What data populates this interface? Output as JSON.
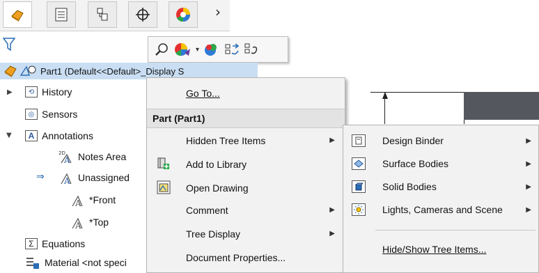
{
  "tabs": {
    "icons": [
      "featuremanager-icon",
      "propertymanager-icon",
      "configurationmanager-icon",
      "dimxpert-icon",
      "display-manager-icon"
    ],
    "overflow": "›"
  },
  "tree": {
    "part_label": "Part1  (Default<<Default>_Display S",
    "items": [
      {
        "label": "History"
      },
      {
        "label": "Sensors"
      },
      {
        "label": "Annotations"
      },
      {
        "label": "Notes Area"
      },
      {
        "label": "Unassigned"
      },
      {
        "label": "*Front"
      },
      {
        "label": "*Top"
      },
      {
        "label": "Equations"
      },
      {
        "label": "Material <not speci"
      }
    ]
  },
  "context_menu": {
    "go_to": "Go To...",
    "header": "Part (Part1)",
    "items": [
      {
        "label": "Hidden Tree Items",
        "has_submenu": true
      },
      {
        "label": "Add to Library",
        "has_submenu": false
      },
      {
        "label": "Open Drawing",
        "has_submenu": false
      },
      {
        "label": "Comment",
        "has_submenu": true
      },
      {
        "label": "Tree Display",
        "has_submenu": true
      },
      {
        "label": "Document Properties...",
        "has_submenu": false
      }
    ]
  },
  "submenu": {
    "items": [
      {
        "label": "Design Binder",
        "has_submenu": true
      },
      {
        "label": "Surface Bodies",
        "has_submenu": true
      },
      {
        "label": "Solid Bodies",
        "has_submenu": true
      },
      {
        "label": "Lights, Cameras and Scene",
        "has_submenu": true
      }
    ],
    "hide_show": "Hide/Show Tree Items..."
  },
  "colors": {
    "selection": "#c9def3",
    "menu_bg": "#f2f2f2",
    "accent_orange": "#f0a020"
  }
}
